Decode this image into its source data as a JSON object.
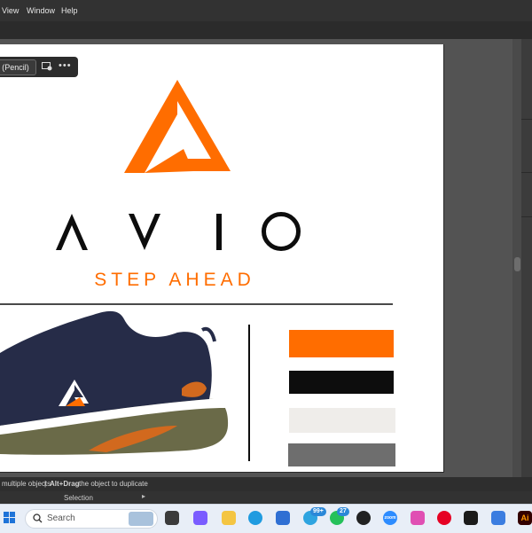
{
  "menubar": {
    "items": [
      "View",
      "Window",
      "Help"
    ]
  },
  "context_toolbar": {
    "tool_label": "(Pencil)",
    "more_icon": "more-horizontal-icon",
    "recolor_icon": "recolor-artwork-icon"
  },
  "artboard": {
    "brand_name": "AVIO",
    "tagline": "STEP AHEAD",
    "colors": {
      "orange": "#ff6d00",
      "black": "#0d0d0d",
      "off_white": "#efedea",
      "gray": "#6e6e6e",
      "shoe_navy": "#262c48",
      "sole_olive": "#6a6a48"
    },
    "palette": [
      "#ff6d00",
      "#0d0d0d",
      "#efedea",
      "#6e6e6e"
    ]
  },
  "statusbar": {
    "hint_left": "multiple objects",
    "separator": "|",
    "hint_bold": "Alt+Drag",
    "hint_rest": "the object to duplicate"
  },
  "selection_bar": {
    "label": "Selection"
  },
  "taskbar": {
    "search_placeholder": "Search",
    "telegram_badge": "99+",
    "whatsapp_badge": "27",
    "zoom_label": "zoom",
    "illustrator_label": "Ai"
  }
}
